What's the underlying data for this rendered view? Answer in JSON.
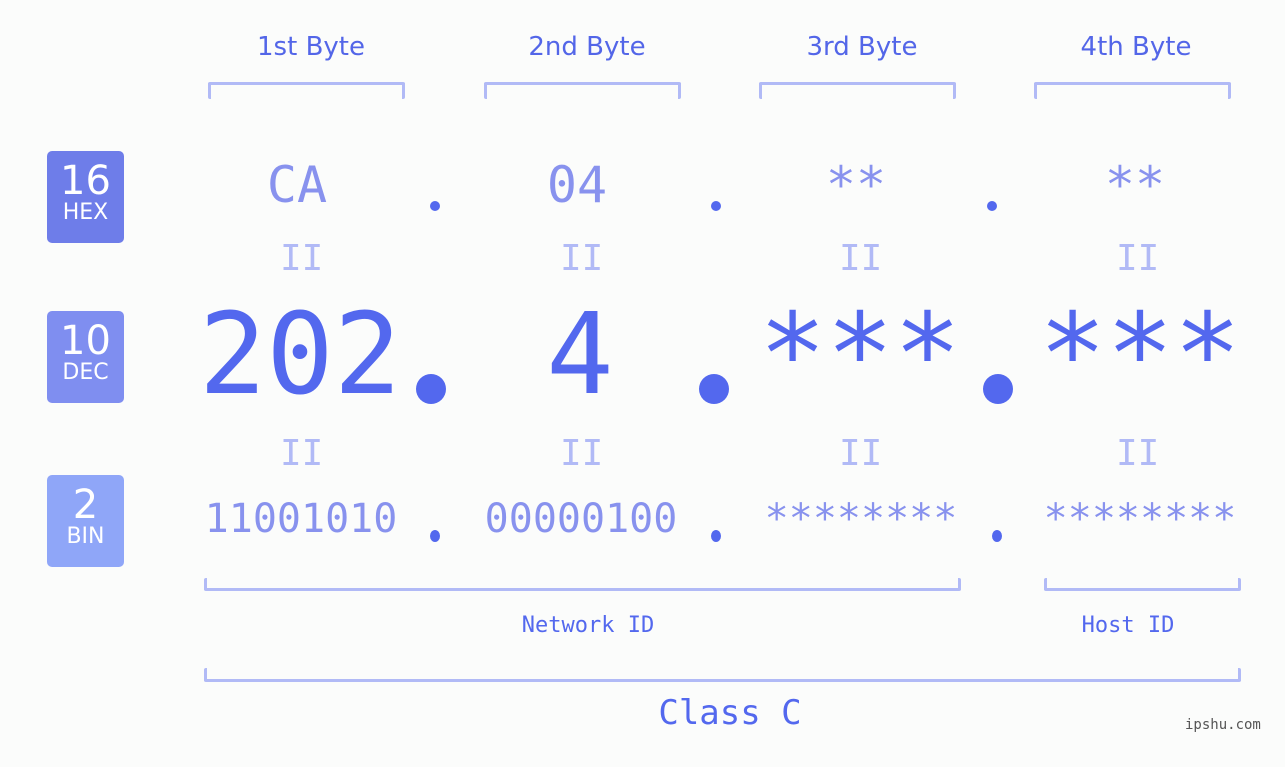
{
  "columns": [
    {
      "label": "1st Byte",
      "hex": "CA",
      "dec": "202",
      "bin": "11001010"
    },
    {
      "label": "2nd Byte",
      "hex": "04",
      "dec": "4",
      "bin": "00000100"
    },
    {
      "label": "3rd Byte",
      "hex": "**",
      "dec": "***",
      "bin": "********"
    },
    {
      "label": "4th Byte",
      "hex": "**",
      "dec": "***",
      "bin": "********"
    }
  ],
  "rows": {
    "hex": {
      "base": "16",
      "name": "HEX",
      "color": "#6e7de9"
    },
    "dec": {
      "base": "10",
      "name": "DEC",
      "color": "#7f8ef0"
    },
    "bin": {
      "base": "2",
      "name": "BIN",
      "color": "#8fa6f8"
    }
  },
  "equals_symbol": "II",
  "segments": {
    "network": "Network ID",
    "host": "Host ID",
    "class": "Class C"
  },
  "watermark": "ipshu.com"
}
